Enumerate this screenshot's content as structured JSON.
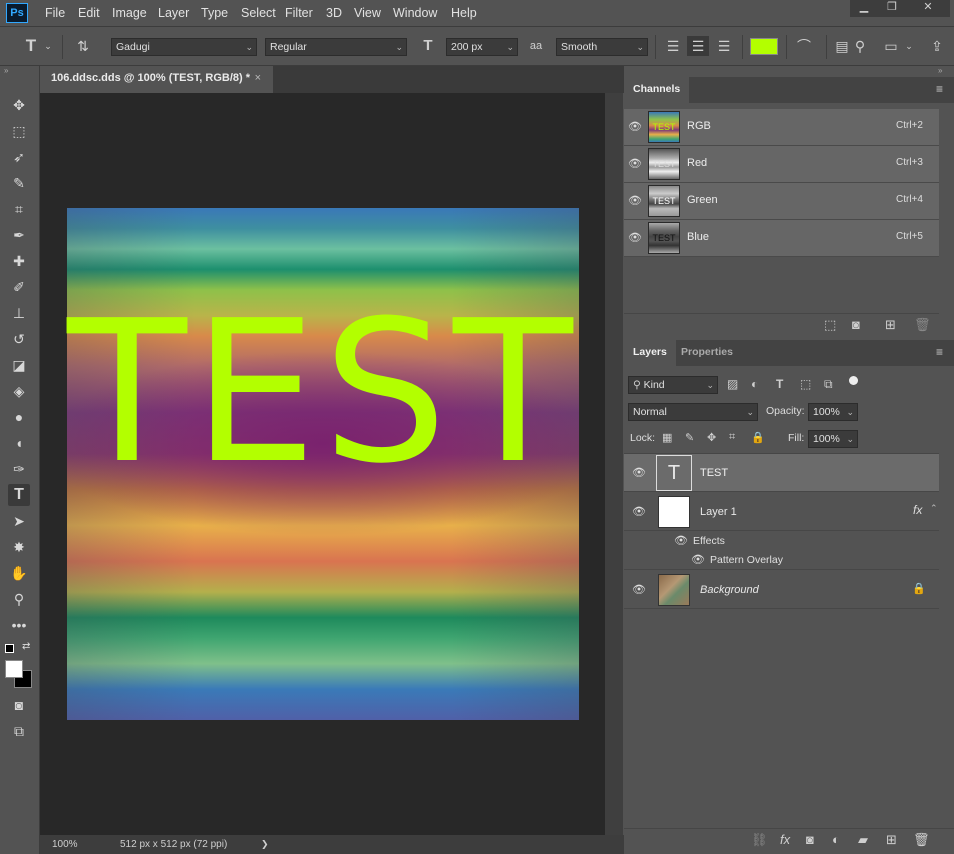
{
  "app": {
    "logo": "Ps"
  },
  "menu": [
    "File",
    "Edit",
    "Image",
    "Layer",
    "Type",
    "Select",
    "Filter",
    "3D",
    "View",
    "Window",
    "Help"
  ],
  "window_controls": {
    "minimize": "▁",
    "restore": "❐",
    "close": "✕"
  },
  "options_bar": {
    "font_family": "Gadugi",
    "font_style": "Regular",
    "font_size": "200 px",
    "antialias_label": "aa",
    "antialias": "Smooth",
    "text_color": "#b3ff00"
  },
  "document_tab": {
    "title": "106.ddsc.dds @ 100% (TEST, RGB/8) *",
    "close": "×"
  },
  "canvas": {
    "text": "TEST"
  },
  "status": {
    "zoom": "100%",
    "doc_info": "512 px x 512 px (72 ppi)",
    "arrow": "❯"
  },
  "channels_panel": {
    "tab": "Channels",
    "channels": [
      {
        "name": "RGB",
        "shortcut": "Ctrl+2"
      },
      {
        "name": "Red",
        "shortcut": "Ctrl+3"
      },
      {
        "name": "Green",
        "shortcut": "Ctrl+4"
      },
      {
        "name": "Blue",
        "shortcut": "Ctrl+5"
      }
    ],
    "thumb_text": "TEST"
  },
  "layers_panel": {
    "tabs": [
      "Layers",
      "Properties"
    ],
    "filter_kind": "Kind",
    "blend_mode": "Normal",
    "opacity_label": "Opacity:",
    "opacity": "100%",
    "lock_label": "Lock:",
    "fill_label": "Fill:",
    "fill": "100%",
    "layers": [
      {
        "name": "TEST",
        "type": "text"
      },
      {
        "name": "Layer 1",
        "type": "pixel",
        "fx": "fx"
      },
      {
        "name": "Effects"
      },
      {
        "name": "Pattern Overlay"
      },
      {
        "name": "Background",
        "type": "background"
      }
    ],
    "text_thumb": "T"
  },
  "colors": {
    "accent": "#b3ff00",
    "panel_bg": "#535353",
    "canvas_bg": "#282828"
  }
}
